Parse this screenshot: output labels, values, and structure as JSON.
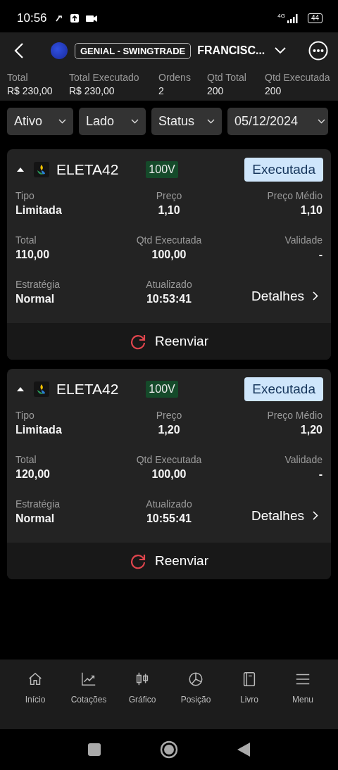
{
  "status_bar": {
    "time": "10:56",
    "network": "4G",
    "battery": "44"
  },
  "header": {
    "account": "GENIAL - SWINGTRADE",
    "user": "FRANCISC..."
  },
  "summary": [
    {
      "label": "Total",
      "value": "R$ 230,00"
    },
    {
      "label": "Total Executado",
      "value": "R$ 230,00"
    },
    {
      "label": "Ordens",
      "value": "2"
    },
    {
      "label": "Qtd Total",
      "value": "200"
    },
    {
      "label": "Qtd Executada",
      "value": "200"
    }
  ],
  "filters": [
    {
      "label": "Ativo"
    },
    {
      "label": "Lado"
    },
    {
      "label": "Status"
    },
    {
      "label": "05/12/2024"
    }
  ],
  "orders": [
    {
      "expanded": true,
      "ticker": "ELETA42",
      "side": "100V",
      "status": "Executada",
      "rows": [
        [
          {
            "label": "Tipo",
            "value": "Limitada"
          },
          {
            "label": "Preço",
            "value": "1,10"
          },
          {
            "label": "Preço Médio",
            "value": "1,10"
          }
        ],
        [
          {
            "label": "Total",
            "value": "110,00"
          },
          {
            "label": "Qtd Executada",
            "value": "100,00"
          },
          {
            "label": "Validade",
            "value": "-"
          }
        ],
        [
          {
            "label": "Estratégia",
            "value": "Normal"
          },
          {
            "label": "Atualizado",
            "value": "10:53:41"
          }
        ]
      ],
      "details": "Detalhes",
      "action": "Reenviar"
    },
    {
      "expanded": true,
      "ticker": "ELETA42",
      "side": "100V",
      "status": "Executada",
      "rows": [
        [
          {
            "label": "Tipo",
            "value": "Limitada"
          },
          {
            "label": "Preço",
            "value": "1,20"
          },
          {
            "label": "Preço Médio",
            "value": "1,20"
          }
        ],
        [
          {
            "label": "Total",
            "value": "120,00"
          },
          {
            "label": "Qtd Executada",
            "value": "100,00"
          },
          {
            "label": "Validade",
            "value": "-"
          }
        ],
        [
          {
            "label": "Estratégia",
            "value": "Normal"
          },
          {
            "label": "Atualizado",
            "value": "10:55:41"
          }
        ]
      ],
      "details": "Detalhes",
      "action": "Reenviar"
    }
  ],
  "bottom_nav": [
    {
      "kind": "home",
      "label": "Início"
    },
    {
      "kind": "quotes",
      "label": "Cotações"
    },
    {
      "kind": "chart",
      "label": "Gráfico"
    },
    {
      "kind": "position",
      "label": "Posição"
    },
    {
      "kind": "book",
      "label": "Livro"
    },
    {
      "kind": "menu",
      "label": "Menu"
    }
  ]
}
